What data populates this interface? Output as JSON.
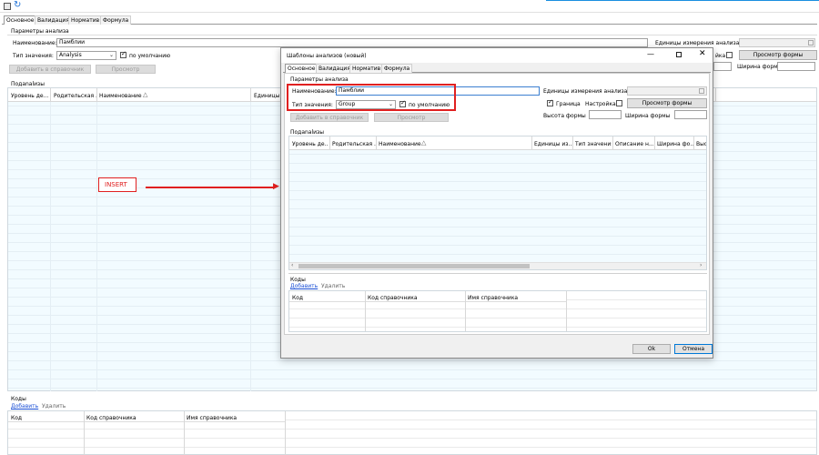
{
  "toolbar": {
    "save_icon": "save-icon",
    "refresh_icon": "refresh-icon"
  },
  "tabs": [
    "Основное",
    "Валидация",
    "Норматив",
    "Формула"
  ],
  "main": {
    "group_title": "Параметры анализа",
    "name_label": "Наименование:",
    "name_value": "Памблии",
    "units_label": "Единицы измерения анализа:",
    "type_label": "Тип значения:",
    "type_value": "Analysis",
    "default_label": "по умолчанию",
    "add_ref_label": "Добавить в справочник",
    "preview_label": "Просмотр",
    "setting_label_partial": "йка",
    "form_preview_label": "Просмотр формы",
    "form_width_label": "Ширина формы",
    "subanalyses_title": "Подanalизы",
    "subanalyses_columns": [
      "Уровень де...",
      "Родительская ...",
      "Наименование",
      "Единицы из"
    ],
    "codes_title": "Коды",
    "codes_add": "Добавить",
    "codes_delete": "Удалить",
    "codes_columns": [
      "Код",
      "Код справочника",
      "Имя справочника"
    ]
  },
  "annotation": {
    "insert_label": "INSERT"
  },
  "dialog": {
    "title": "Шаблоны анализов (новый)",
    "tabs": [
      "Основное",
      "Валидация",
      "Норматив",
      "Формула"
    ],
    "group_title": "Параметры анализа",
    "name_label": "Наименование:",
    "name_value": "Памблии",
    "units_label": "Единицы измерения анализа:",
    "type_label": "Тип значения:",
    "type_value": "Group",
    "default_label": "по умолчанию",
    "border_label": "Граница",
    "setting_label": "Настройка",
    "form_preview_label": "Просмотр формы",
    "add_ref_label": "Добавить в справочник",
    "preview_label": "Просмотр",
    "form_height_label": "Высота формы",
    "form_width_label": "Ширина формы",
    "subanalyses_title": "Подanalизы",
    "subanalyses_columns": [
      "Уровень де...",
      "Родительская ...",
      "Наименование",
      "Единицы из...",
      "Тип значения",
      "Описание н...",
      "Ширина фо...",
      "Выс"
    ],
    "codes_title": "Коды",
    "codes_add": "Добавить",
    "codes_delete": "Удалить",
    "codes_columns": [
      "Код",
      "Код справочника",
      "Имя справочника"
    ],
    "ok_label": "Ok",
    "cancel_label": "Отмена"
  },
  "colors": {
    "highlight": "#e02020",
    "link": "#1a4fd6",
    "grid": "#f2fbff"
  }
}
